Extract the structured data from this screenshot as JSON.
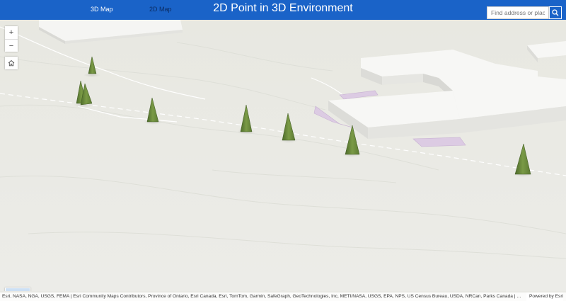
{
  "header": {
    "title": "2D Point in 3D Environment",
    "tabs": [
      {
        "label": "3D Map",
        "active": true
      },
      {
        "label": "2D Map",
        "active": false
      }
    ],
    "search": {
      "placeholder": "Find address or place",
      "value": ""
    }
  },
  "controls": {
    "zoom_in": "+",
    "zoom_out": "−",
    "home_icon": "home-icon",
    "overview_icon": "overview-map-icon",
    "bottom_buttons": [
      "layers-icon",
      "legend-list-icon",
      "calculator-icon"
    ]
  },
  "attribution": {
    "text": "Esri, NASA, NGA, USGS, FEMA | Esri Community Maps Contributors, Province of Ontario, Esri Canada, Esri, TomTom, Garmin, SafeGraph, GeoTechnologies, Inc, METI/NASA, USGS, EPA, NPS, US Census Bureau, USDA, NRCan, Parks Canada | Source: Airbus, USGS,...",
    "powered_by": "Powered by Esri"
  },
  "colors": {
    "header": "#1a63c8",
    "ground": "#e9e9e4",
    "building": "#f7f7f5",
    "tree": "#6a8a3a",
    "highlight": "#d8c8e0"
  }
}
